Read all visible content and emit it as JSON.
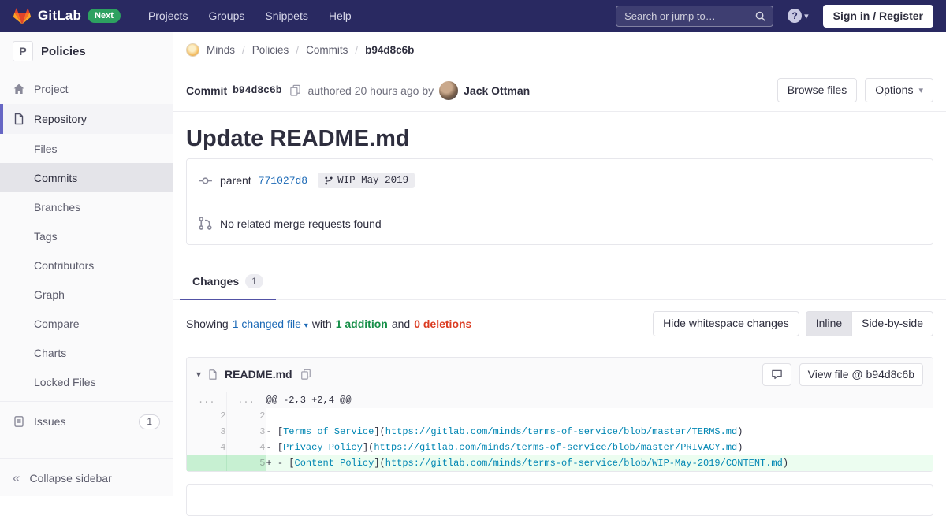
{
  "navbar": {
    "brand": "GitLab",
    "next_badge": "Next",
    "links": [
      "Projects",
      "Groups",
      "Snippets",
      "Help"
    ],
    "search_placeholder": "Search or jump to…",
    "sign_in_label": "Sign in / Register"
  },
  "sidebar": {
    "project_initial": "P",
    "project_name": "Policies",
    "project_item": "Project",
    "repository_item": "Repository",
    "repo_subitems": [
      "Files",
      "Commits",
      "Branches",
      "Tags",
      "Contributors",
      "Graph",
      "Compare",
      "Charts",
      "Locked Files"
    ],
    "issues_label": "Issues",
    "issues_count": "1",
    "collapse_label": "Collapse sidebar"
  },
  "breadcrumb": {
    "items": [
      "Minds",
      "Policies",
      "Commits"
    ],
    "current": "b94d8c6b"
  },
  "commit_header": {
    "label": "Commit",
    "sha": "b94d8c6b",
    "authored_text": "authored 20 hours ago by",
    "author": "Jack Ottman",
    "browse_files_label": "Browse files",
    "options_label": "Options"
  },
  "commit": {
    "title": "Update README.md",
    "parent_label": "parent",
    "parent_sha": "771027d8",
    "branch_label": "WIP-May-2019",
    "no_mr_text": "No related merge requests found"
  },
  "tabs": {
    "changes_label": "Changes",
    "changes_count": "1"
  },
  "diff_stats": {
    "showing": "Showing",
    "changed_files": "1 changed file",
    "with_text": "with",
    "additions": "1 addition",
    "and_text": "and",
    "deletions": "0 deletions",
    "hide_whitespace_label": "Hide whitespace changes",
    "inline_label": "Inline",
    "side_by_side_label": "Side-by-side"
  },
  "file_diff": {
    "filename": "README.md",
    "view_file_label": "View file @ b94d8c6b",
    "rows": [
      {
        "old": "...",
        "new": "...",
        "type": "hunk",
        "segments": [
          {
            "t": "@@ -2,3 +2,4 @@",
            "c": "plain"
          }
        ]
      },
      {
        "old": "2",
        "new": "2",
        "type": "context",
        "segments": []
      },
      {
        "old": "3",
        "new": "3",
        "type": "context",
        "segments": [
          {
            "t": "- [",
            "c": "plain"
          },
          {
            "t": "Terms of Service",
            "c": "link"
          },
          {
            "t": "](",
            "c": "plain"
          },
          {
            "t": "https://gitlab.com/minds/terms-of-service/blob/master/TERMS.md",
            "c": "url"
          },
          {
            "t": ")",
            "c": "plain"
          }
        ]
      },
      {
        "old": "4",
        "new": "4",
        "type": "context",
        "segments": [
          {
            "t": "- [",
            "c": "plain"
          },
          {
            "t": "Privacy Policy",
            "c": "link"
          },
          {
            "t": "](",
            "c": "plain"
          },
          {
            "t": "https://gitlab.com/minds/terms-of-service/blob/master/PRIVACY.md",
            "c": "url"
          },
          {
            "t": ")",
            "c": "plain"
          }
        ]
      },
      {
        "old": "",
        "new": "5",
        "type": "add",
        "segments": [
          {
            "t": "+ - [",
            "c": "plain"
          },
          {
            "t": "Content Policy",
            "c": "link"
          },
          {
            "t": "](",
            "c": "plain"
          },
          {
            "t": "https://gitlab.com/minds/terms-of-service/blob/WIP-May-2019/CONTENT.md",
            "c": "url"
          },
          {
            "t": ")",
            "c": "plain"
          }
        ]
      }
    ]
  },
  "icons": {
    "caret_down": "▾",
    "collapse_double_chevron": "«",
    "help_glyph": "?",
    "hunk_ellipsis": "..."
  },
  "colors": {
    "navbar_bg": "#292961",
    "accent_indigo": "#6666c4",
    "link_blue": "#1b69b6",
    "addition_green": "#168f48",
    "deletion_red": "#db3b21",
    "added_line_bg": "#ecfdf0",
    "added_line_number_bg": "#c7f0d2",
    "next_badge_green": "#2da160",
    "code_token_blue": "#0086b3"
  }
}
